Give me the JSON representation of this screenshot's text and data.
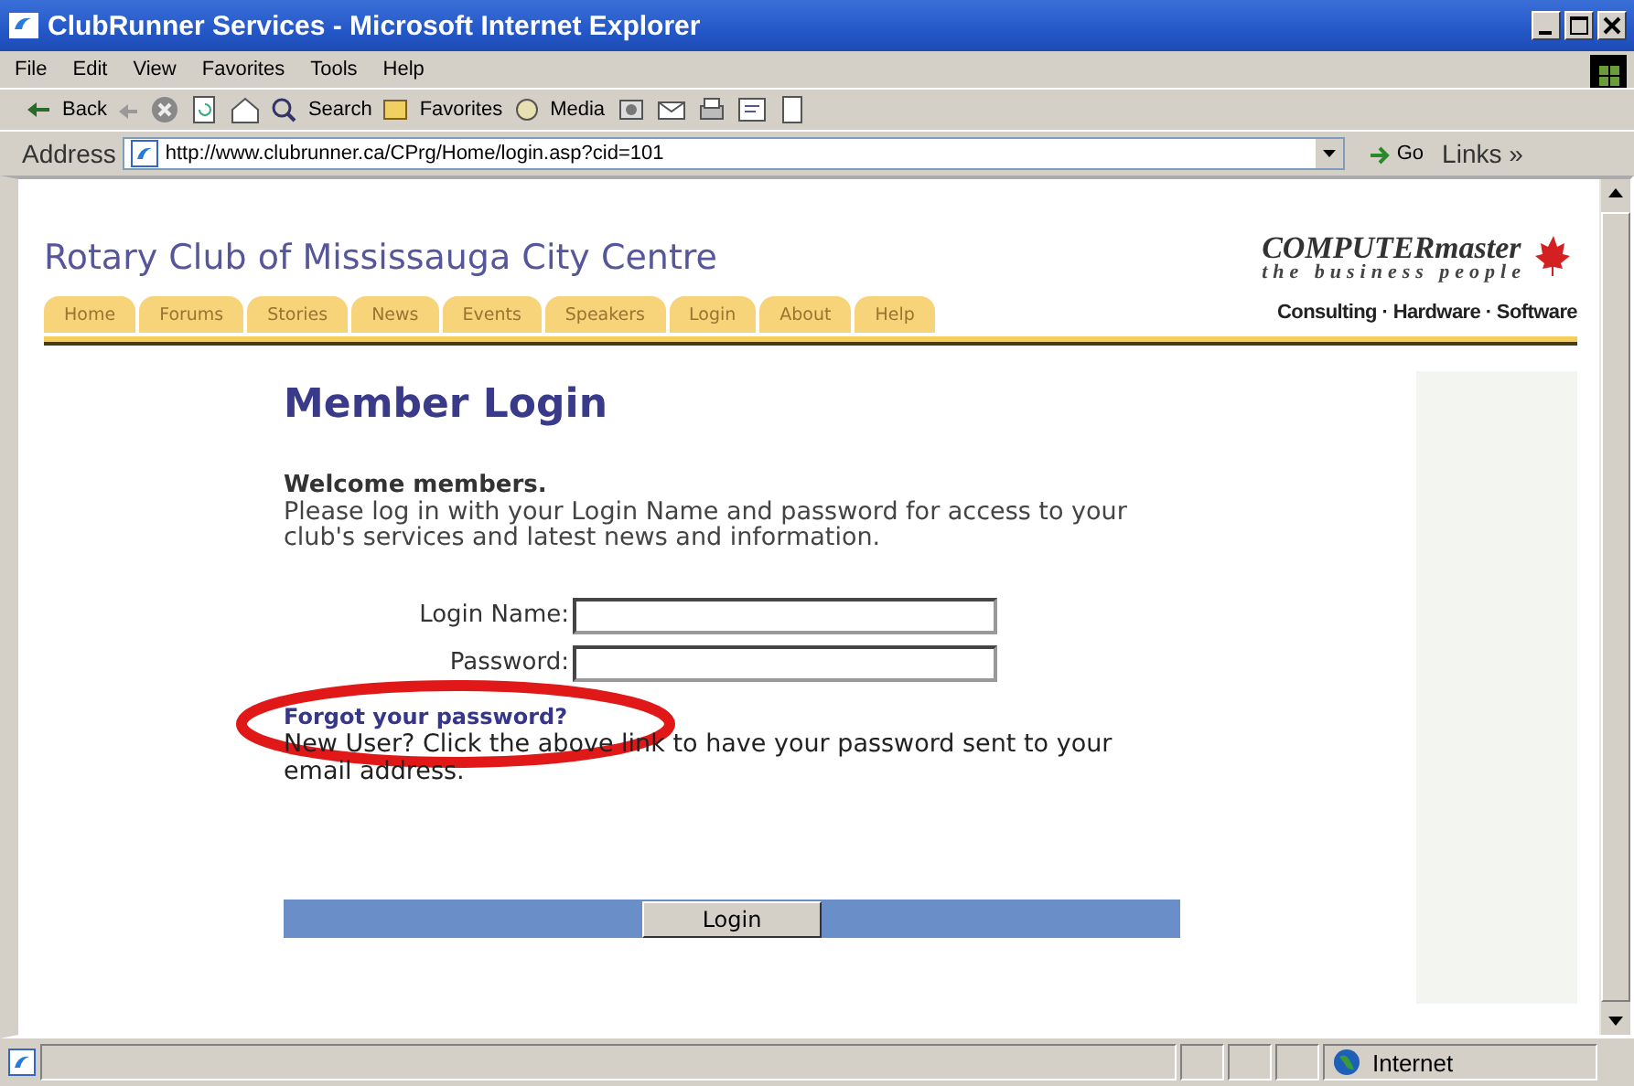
{
  "window": {
    "title": "ClubRunner Services - Microsoft Internet Explorer"
  },
  "menu": [
    "File",
    "Edit",
    "View",
    "Favorites",
    "Tools",
    "Help"
  ],
  "toolbar": [
    {
      "kind": "button",
      "label": "Back"
    },
    {
      "kind": "button",
      "label": "Search"
    },
    {
      "kind": "button",
      "label": "Favorites"
    },
    {
      "kind": "button",
      "label": "Media"
    }
  ],
  "address": {
    "label": "Address",
    "url": "http://www.clubrunner.ca/CPrg/Home/login.asp?cid=101",
    "go": "Go",
    "links": "Links »"
  },
  "site": {
    "title": "Rotary Club of Mississauga City Centre",
    "tabs": [
      {
        "label": "Home",
        "selected": false
      },
      {
        "label": "Forums",
        "selected": false
      },
      {
        "label": "Stories",
        "selected": false
      },
      {
        "label": "News",
        "selected": false
      },
      {
        "label": "Events",
        "selected": false
      },
      {
        "label": "Speakers",
        "selected": false
      },
      {
        "label": "Login",
        "selected": false
      },
      {
        "label": "About",
        "selected": false
      },
      {
        "label": "Help",
        "selected": false
      }
    ],
    "logo": {
      "name": "COMPUTERmaster",
      "tagline": "the business people",
      "services": "Consulting · Hardware · Software"
    }
  },
  "login": {
    "heading": "Member Login",
    "welcome": "Welcome members.",
    "intro": "Please log in with your Login Name and password for access to your club's services and latest news and information.",
    "fields": [
      {
        "label": "Login Name:"
      },
      {
        "label": "Password:"
      }
    ],
    "forgot_link": "Forgot your password?",
    "note": "New User? Click the above link to have your password sent to your email address.",
    "button": "Login"
  },
  "status_bar": {
    "zone": "Internet"
  }
}
